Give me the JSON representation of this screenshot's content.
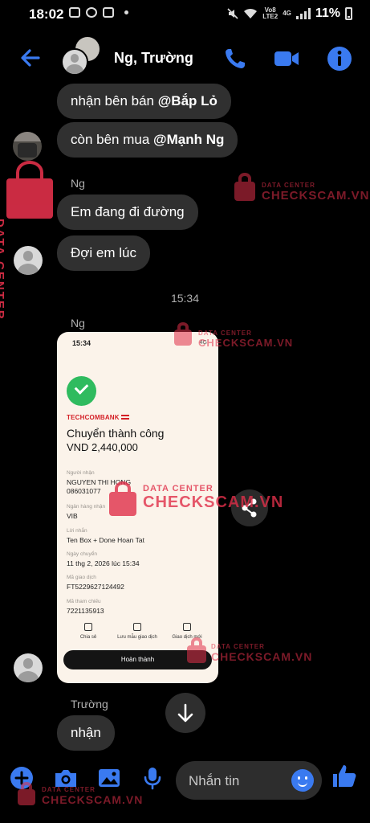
{
  "status_bar": {
    "time": "18:02",
    "network_top": "Vo8",
    "network_bottom": "LTE2",
    "network_type": "4G",
    "battery": "11%"
  },
  "header": {
    "contact_name": "Ng, Trường"
  },
  "messages": {
    "m1": {
      "prefix": "nhận bên bán ",
      "mention": "@Bắp Lỏ"
    },
    "m2": {
      "prefix": "còn bên mua ",
      "mention": "@Mạnh Ng"
    },
    "sender1": "Ng",
    "m3": "Em đang đi đường",
    "m4": "Đợi em lúc",
    "timestamp": "15:34",
    "sender2": "Ng",
    "sender3": "Trường",
    "m5": "nhận"
  },
  "receipt": {
    "time": "15:34",
    "signal": "4G",
    "bank": "TECHCOMBANK",
    "title": "Chuyển thành công",
    "amount": "VND 2,440,000",
    "recipient_label": "Người nhận",
    "recipient_name": "NGUYEN THI HONG",
    "recipient_account": "086031077",
    "bank_label": "Ngân hàng nhận",
    "bank_value": "VIB",
    "note_label": "Lời nhắn",
    "note_value": "Ten Box + Done Hoan Tat",
    "date_label": "Ngày chuyển",
    "date_value": "11 thg 2, 2026 lúc 15:34",
    "txn_label": "Mã giao dịch",
    "txn_value": "FT5229627124492",
    "ref_label": "Mã tham chiếu",
    "ref_value": "7221135913",
    "action_share": "Chia sẻ",
    "action_save": "Lưu mẫu giao dịch",
    "action_history": "Giao dịch mới",
    "done_button": "Hoàn thành"
  },
  "composer": {
    "placeholder": "Nhắn tin"
  },
  "watermark": {
    "small": "DATA CENTER",
    "big": "CHECKSCAM.VN"
  },
  "colors": {
    "accent": "#3a7af0",
    "bubble": "#303030",
    "watermark": "#e0304a",
    "success": "#2fbb5f",
    "bank_red": "#d41f26"
  }
}
